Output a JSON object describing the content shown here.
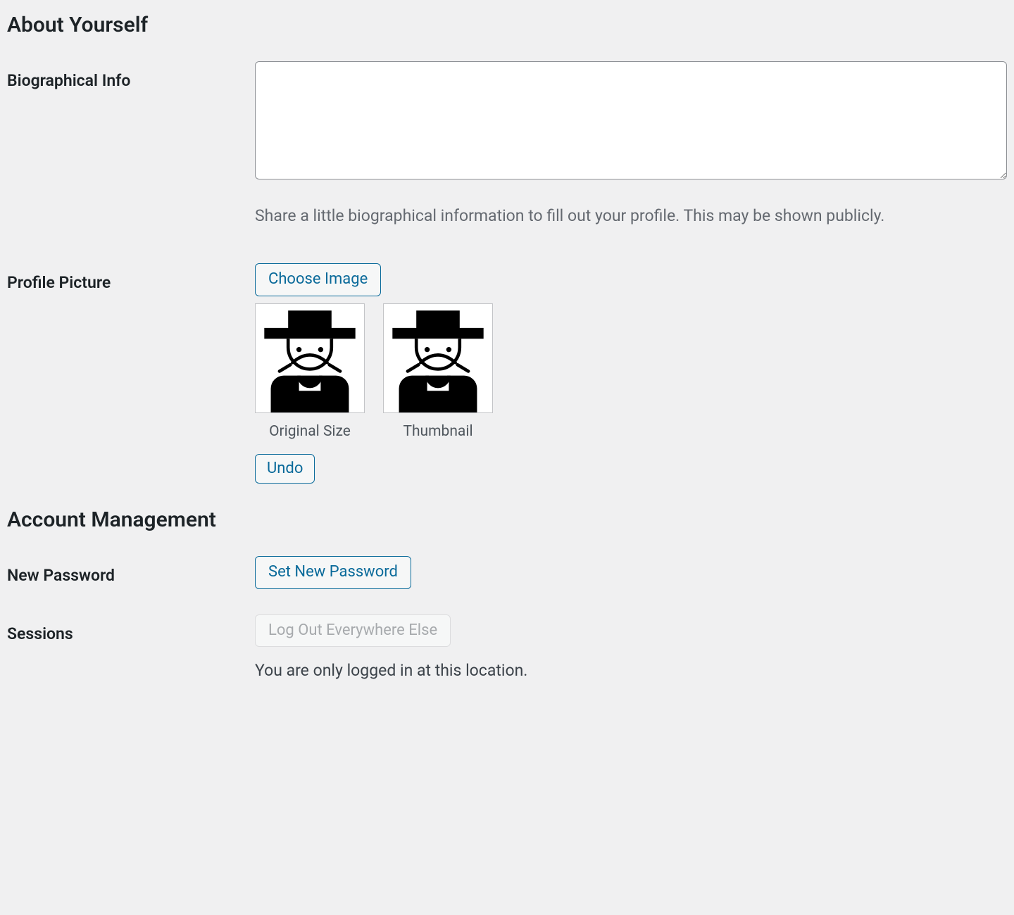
{
  "sections": {
    "about": {
      "heading": "About Yourself",
      "bio": {
        "label": "Biographical Info",
        "value": "",
        "help": "Share a little biographical information to fill out your profile. This may be shown publicly."
      },
      "picture": {
        "label": "Profile Picture",
        "choose_image": "Choose Image",
        "original_caption": "Original Size",
        "thumbnail_caption": "Thumbnail",
        "undo": "Undo"
      }
    },
    "account": {
      "heading": "Account Management",
      "password": {
        "label": "New Password",
        "set_button": "Set New Password"
      },
      "sessions": {
        "label": "Sessions",
        "logout_button": "Log Out Everywhere Else",
        "help": "You are only logged in at this location."
      }
    }
  }
}
